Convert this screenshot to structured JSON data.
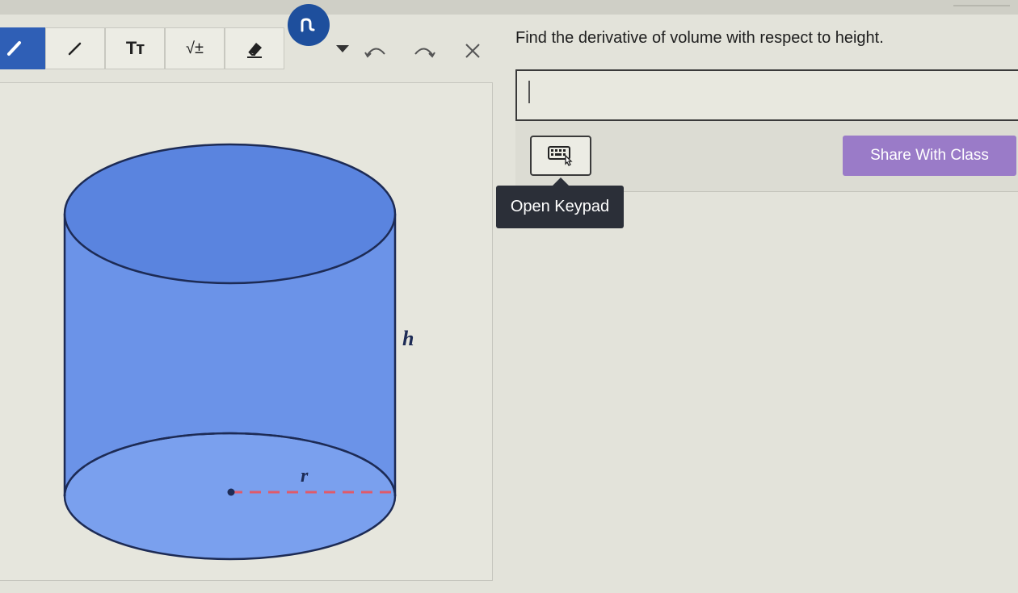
{
  "toolbar": {
    "tools": [
      {
        "name": "pen",
        "active": true
      },
      {
        "name": "line",
        "active": false
      },
      {
        "name": "text",
        "label": "Tт"
      },
      {
        "name": "math",
        "label": "√±"
      },
      {
        "name": "eraser"
      }
    ],
    "color": "#1e4f9d",
    "icons": [
      "pen-icon",
      "line-icon",
      "text-icon",
      "math-icon",
      "eraser-icon",
      "squiggle-icon",
      "undo-icon",
      "redo-icon",
      "close-icon"
    ]
  },
  "figure": {
    "height_label": "h",
    "radius_label": "r",
    "fill_color": "#5f8ae6",
    "radius_color": "#e05a6a"
  },
  "question": {
    "prompt": "Find the derivative of volume with respect to height.",
    "answer_value": "",
    "keypad_icon": "keyboard-icon",
    "share_label": "Share With Class",
    "tooltip": "Open Keypad",
    "accent": "#9a7bc8"
  }
}
